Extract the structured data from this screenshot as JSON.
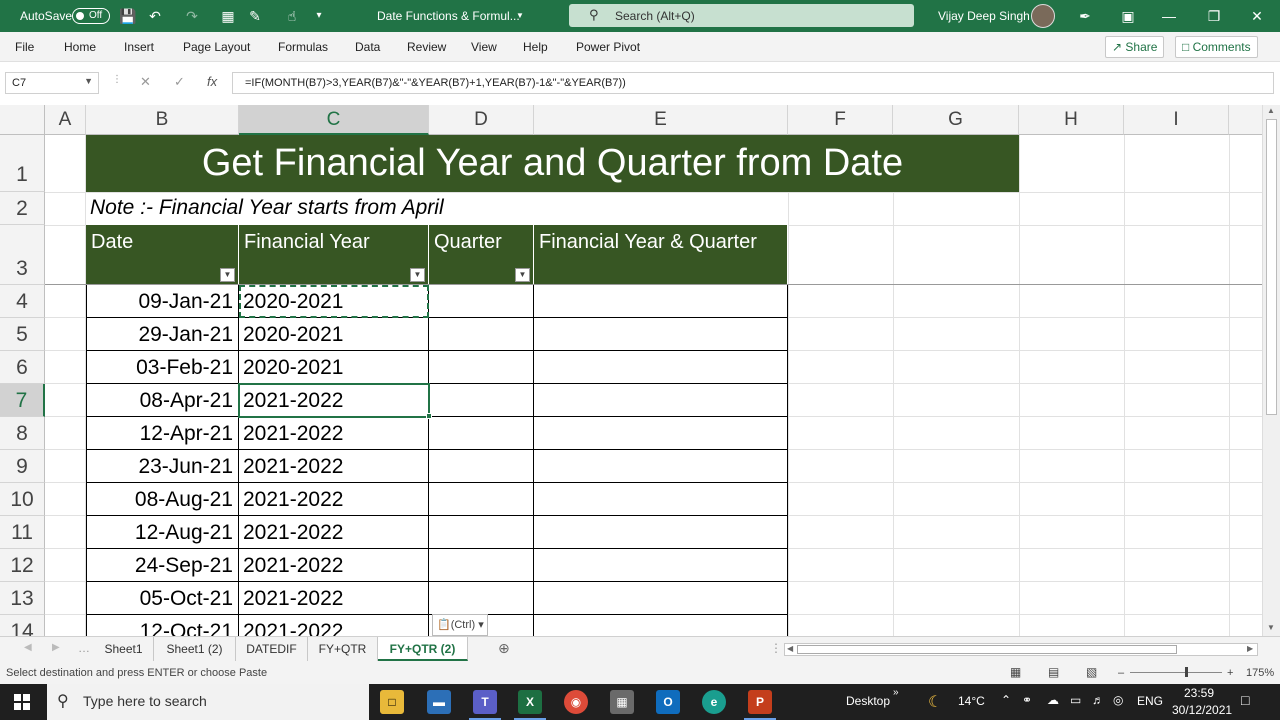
{
  "titlebar": {
    "autosave_label": "AutoSave",
    "autosave_state": "Off",
    "doc_title": "Date Functions & Formul...",
    "search_placeholder": "Search (Alt+Q)",
    "user_name": "Vijay Deep Singh"
  },
  "menu": {
    "items": [
      "File",
      "Home",
      "Insert",
      "Page Layout",
      "Formulas",
      "Data",
      "Review",
      "View",
      "Help",
      "Power Pivot"
    ],
    "share_label": "Share",
    "comments_label": "Comments"
  },
  "formula_bar": {
    "name_box": "C7",
    "formula": "=IF(MONTH(B7)>3,YEAR(B7)&\"-\"&YEAR(B7)+1,YEAR(B7)-1&\"-\"&YEAR(B7))"
  },
  "grid": {
    "columns": [
      "A",
      "B",
      "C",
      "D",
      "E",
      "F",
      "G",
      "H",
      "I"
    ],
    "rows": [
      "1",
      "2",
      "3",
      "4",
      "5",
      "6",
      "7",
      "8",
      "9",
      "10",
      "11",
      "12",
      "13",
      "14"
    ],
    "selected_column": "C",
    "selected_row": "7",
    "title": "Get Financial Year and Quarter from Date",
    "note": "Note :- Financial Year starts from April",
    "headers": [
      "Date",
      "Financial Year",
      "Quarter",
      "Financial Year & Quarter"
    ],
    "data_rows": [
      {
        "date": "09-Jan-21",
        "fy": "2020-2021"
      },
      {
        "date": "29-Jan-21",
        "fy": "2020-2021"
      },
      {
        "date": "03-Feb-21",
        "fy": "2020-2021"
      },
      {
        "date": "08-Apr-21",
        "fy": "2021-2022"
      },
      {
        "date": "12-Apr-21",
        "fy": "2021-2022"
      },
      {
        "date": "23-Jun-21",
        "fy": "2021-2022"
      },
      {
        "date": "08-Aug-21",
        "fy": "2021-2022"
      },
      {
        "date": "12-Aug-21",
        "fy": "2021-2022"
      },
      {
        "date": "24-Sep-21",
        "fy": "2021-2022"
      },
      {
        "date": "05-Oct-21",
        "fy": "2021-2022"
      },
      {
        "date": "12-Oct-21",
        "fy": "2021-2022"
      }
    ],
    "paste_options_label": "(Ctrl)"
  },
  "sheet_tabs": {
    "tabs": [
      "Sheet1",
      "Sheet1 (2)",
      "DATEDIF",
      "FY+QTR",
      "FY+QTR (2)"
    ],
    "active": "FY+QTR (2)"
  },
  "status": {
    "message": "Select destination and press ENTER or choose Paste",
    "zoom": "175%"
  },
  "taskbar": {
    "search_placeholder": "Type here to search",
    "desktop_label": "Desktop",
    "temperature": "14°C",
    "language": "ENG",
    "time": "23:59",
    "date": "30/12/2021"
  }
}
